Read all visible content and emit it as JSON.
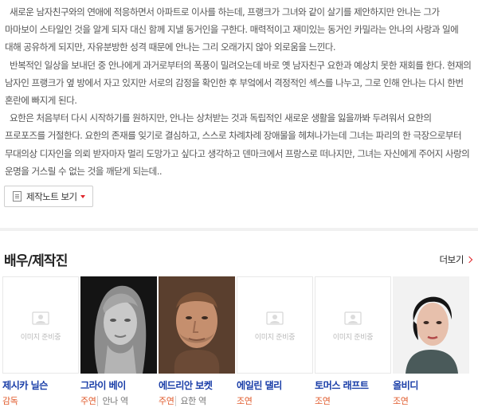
{
  "synopsis": [
    "새로운 남자친구와의 연애에 적응하면서 아파트로 이사를 하는데, 프랭크가 그녀와 같이 살기를 제안하지만 안나는 그가 마마보이 스타일인 것을 알게 되자 대신 함께 지낼 동거인을 구한다. 매력적이고 재미있는 동거인 카밀라는 안나의 사랑과 일에 대해 공유하게 되지만, 자유분방한 성격 때문에 안나는 그리 오래가지 않아 외로움을 느낀다.",
    "반복적인 일상을 보내던 중 안나에게 과거로부터의 폭풍이 밀려오는데 바로 옛 남자친구 요한과 예상치 못한 재회를 한다. 현재의 남자인 프랭크가 옆 방에서 자고 있지만 서로의 감정을 확인한 후 부엌에서 격정적인 섹스를 나누고, 그로 인해 안나는 다시 한번 혼란에 빠지게 된다.",
    "요한은 처음부터 다시 시작하기를 원하지만, 안나는 상처받는 것과 독립적인 새로운 생활을 잃을까봐 두려워서 요한의 프로포즈를 거절한다. 요한의 존재를 잊기로 결심하고, 스스로 차례차례 장애물을 헤쳐나가는데 그녀는 파리의 한 극장으로부터 무대의상 디자인을 의뢰 받자마자 멀리 도망가고 싶다고 생각하고 덴마크에서 프랑스로 떠나지만, 그녀는 자신에게 주어지 사랑의 운명을 거스릴 수 없는 것을 깨닫게 되는데.."
  ],
  "note_button": {
    "label": "제작노트 보기",
    "icon": "document-icon",
    "caret_icon": "caret-down-icon"
  },
  "section": {
    "title": "배우/제작진",
    "more_label": "더보기"
  },
  "placeholder_text": "이미지 준비중",
  "colors": {
    "accent": "#e0252b",
    "name": "#1a3ea8",
    "role": "#e05a2b"
  },
  "cast": [
    {
      "name": "제시카 닐슨",
      "role": "감독",
      "character": "",
      "photo": "placeholder"
    },
    {
      "name": "그라이 베이",
      "role": "주연",
      "character": "안나 역",
      "photo": "woman-blonde"
    },
    {
      "name": "에드리안 보켓",
      "role": "주연",
      "character": "요한 역",
      "photo": "man-stubble"
    },
    {
      "name": "에일린 댈리",
      "role": "조연",
      "character": "",
      "photo": "placeholder"
    },
    {
      "name": "토머스 래프트",
      "role": "조연",
      "character": "",
      "photo": "placeholder"
    },
    {
      "name": "올비디",
      "role": "조연",
      "character": "",
      "photo": "woman-dark-hair"
    }
  ]
}
